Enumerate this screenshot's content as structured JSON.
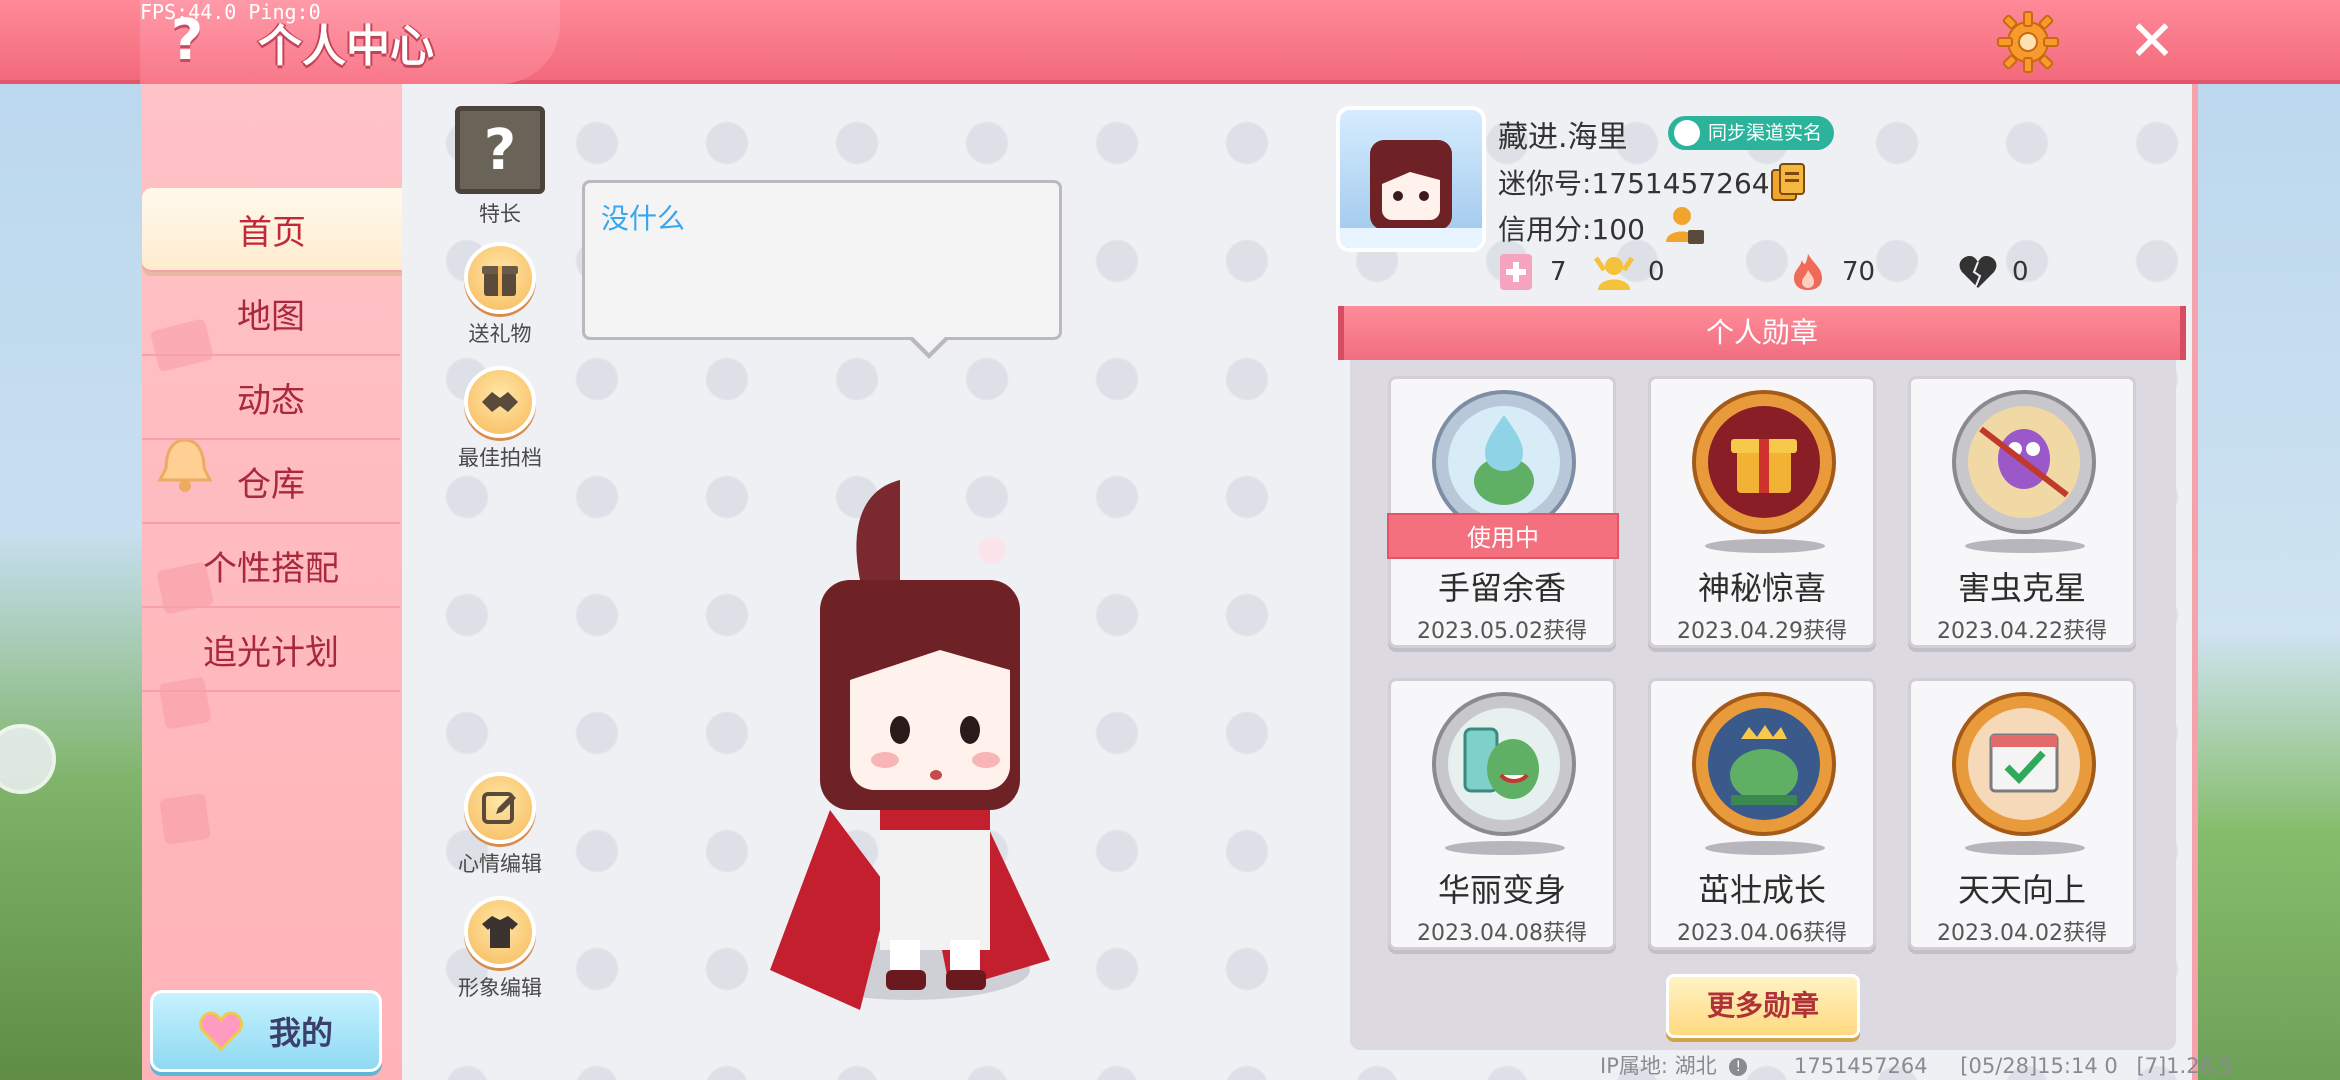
{
  "topbar": {
    "fps_text": "FPS:44.0  Ping:0",
    "help_glyph": "?",
    "title": "个人中心",
    "close_glyph": "✕"
  },
  "sidenav": {
    "items": [
      {
        "label": "首页",
        "active": true
      },
      {
        "label": "地图"
      },
      {
        "label": "动态"
      },
      {
        "label": "仓库"
      },
      {
        "label": "个性搭配"
      },
      {
        "label": "追光计划"
      }
    ],
    "my_button": "我的"
  },
  "tools": {
    "specialty": {
      "glyph": "?",
      "label": "特长"
    },
    "send_gift": {
      "label": "送礼物"
    },
    "best_partner": {
      "label": "最佳拍档"
    },
    "mood_edit": {
      "label": "心情编辑"
    },
    "image_edit": {
      "label": "形象编辑"
    }
  },
  "speech": {
    "text": "没什么"
  },
  "profile": {
    "username": "藏进.海里",
    "realname_badge": "同步渠道实名",
    "mini_id": "迷你号:1751457264",
    "credit": "信用分:100",
    "stats": [
      {
        "icon": "bookmark-plus-icon",
        "value": "7",
        "color": "#f6a3c0"
      },
      {
        "icon": "fan-person-icon",
        "value": "0",
        "color": "#f5c33b"
      },
      {
        "icon": "flame-icon",
        "value": "70",
        "color": "#f06a5a"
      },
      {
        "icon": "broken-heart-icon",
        "value": "0",
        "color": "#333333"
      }
    ]
  },
  "medals": {
    "header": "个人勋章",
    "in_use_label": "使用中",
    "items": [
      {
        "name": "手留余香",
        "date": "2023.05.02获得",
        "in_use": true,
        "style": "silver-blue"
      },
      {
        "name": "神秘惊喜",
        "date": "2023.04.29获得",
        "style": "gold"
      },
      {
        "name": "害虫克星",
        "date": "2023.04.22获得",
        "style": "silver"
      },
      {
        "name": "华丽变身",
        "date": "2023.04.08获得",
        "style": "silver"
      },
      {
        "name": "茁壮成长",
        "date": "2023.04.06获得",
        "style": "gold"
      },
      {
        "name": "天天向上",
        "date": "2023.04.02获得",
        "style": "gold"
      }
    ],
    "more_button": "更多勋章"
  },
  "footer": {
    "ip_location": "IP属地: 湖北",
    "id": "1751457264",
    "timestamp": "[05/28]15:14 0",
    "version": "[7]1.26.5"
  },
  "colors": {
    "accent": "#f26a7c",
    "nav_bg": "#ffb3b8",
    "nav_text": "#a8283c",
    "badge_green": "#2bb39b"
  }
}
